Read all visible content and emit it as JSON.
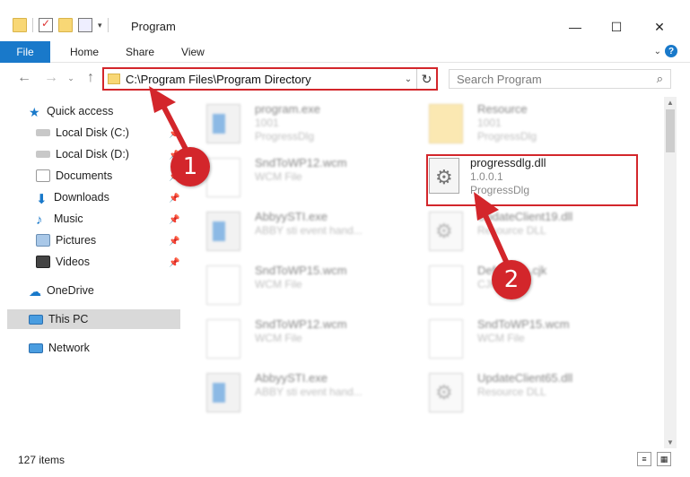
{
  "window": {
    "title": "Program",
    "minimize": "—",
    "maximize": "☐",
    "close": "✕"
  },
  "ribbon": {
    "tabs": [
      "File",
      "Home",
      "Share",
      "View"
    ],
    "help": "?"
  },
  "nav": {
    "address": "C:\\Program Files\\Program Directory",
    "search_placeholder": "Search Program"
  },
  "sidebar": {
    "items": [
      {
        "label": "Quick access",
        "icon": "star-icon"
      },
      {
        "label": "Local Disk (C:)",
        "icon": "drive-icon"
      },
      {
        "label": "Local Disk (D:)",
        "icon": "drive-icon"
      },
      {
        "label": "Documents",
        "icon": "documents-icon"
      },
      {
        "label": "Downloads",
        "icon": "download-icon"
      },
      {
        "label": "Music",
        "icon": "music-icon"
      },
      {
        "label": "Pictures",
        "icon": "pictures-icon"
      },
      {
        "label": "Videos",
        "icon": "videos-icon"
      },
      {
        "label": "OneDrive",
        "icon": "cloud-icon"
      },
      {
        "label": "This PC",
        "icon": "computer-icon"
      },
      {
        "label": "Network",
        "icon": "network-icon"
      }
    ]
  },
  "files": [
    {
      "name": "program.exe",
      "sub1": "1001",
      "sub2": "ProgressDlg",
      "icon": "exe-icon"
    },
    {
      "name": "Resource",
      "sub1": "1001",
      "sub2": "ProgressDlg",
      "icon": "folder-icon"
    },
    {
      "name": "SndToWP12.wcm",
      "sub1": "WCM File",
      "sub2": "",
      "icon": "document-icon"
    },
    {
      "name": "progressdlg.dll",
      "sub1": "1.0.0.1",
      "sub2": "ProgressDlg",
      "icon": "gear-icon"
    },
    {
      "name": "AbbyySTI.exe",
      "sub1": "ABBY sti event hand...",
      "sub2": "",
      "icon": "exe-icon"
    },
    {
      "name": "UpdateClient19.dll",
      "sub1": "Resource DLL",
      "sub2": "",
      "icon": "gear-icon"
    },
    {
      "name": "SndToWP15.wcm",
      "sub1": "WCM File",
      "sub2": "",
      "icon": "document-icon"
    },
    {
      "name": "DefaultC...cjk",
      "sub1": "CJK",
      "sub2": "",
      "icon": "document-icon"
    },
    {
      "name": "SndToWP12.wcm",
      "sub1": "WCM File",
      "sub2": "",
      "icon": "document-icon"
    },
    {
      "name": "SndToWP15.wcm",
      "sub1": "WCM File",
      "sub2": "",
      "icon": "document-icon"
    },
    {
      "name": "AbbyySTI.exe",
      "sub1": "ABBY sti event hand...",
      "sub2": "",
      "icon": "exe-icon"
    },
    {
      "name": "UpdateClient65.dll",
      "sub1": "Resource DLL",
      "sub2": "",
      "icon": "gear-icon"
    }
  ],
  "status": {
    "count": "127 items"
  },
  "annotations": {
    "step1": "1",
    "step2": "2",
    "color": "#d3262b"
  }
}
